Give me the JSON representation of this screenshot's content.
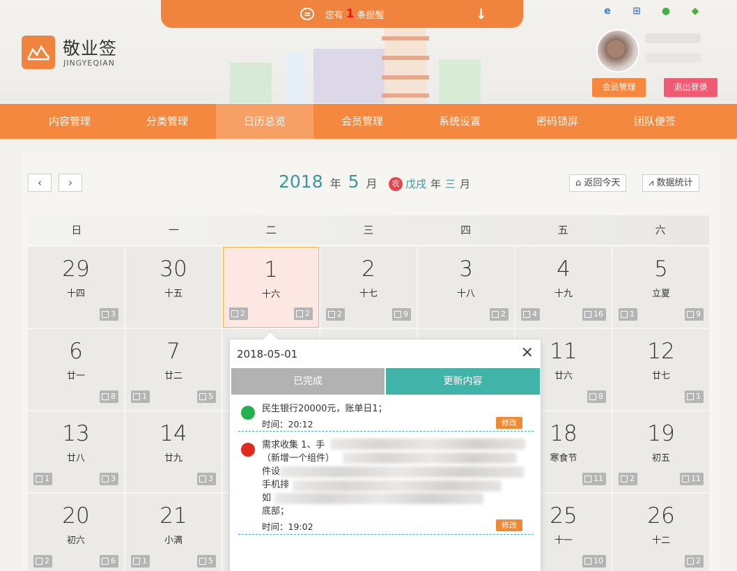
{
  "reminder": {
    "prefix": "您有",
    "count": "1",
    "suffix": "条提醒"
  },
  "brand": {
    "name": "敬业签",
    "sub": "JINGYEQIAN"
  },
  "user": {
    "member_btn": "会员管理",
    "logout_btn": "退出登录"
  },
  "nav": [
    {
      "label": "内容管理",
      "active": false
    },
    {
      "label": "分类管理",
      "active": false
    },
    {
      "label": "日历总览",
      "active": true
    },
    {
      "label": "会员管理",
      "active": false
    },
    {
      "label": "系统设置",
      "active": false
    },
    {
      "label": "密码锁屏",
      "active": false
    },
    {
      "label": "团队便签",
      "active": false
    }
  ],
  "calendar": {
    "year": "2018",
    "year_unit": "年",
    "month": "5",
    "month_unit": "月",
    "lunar_badge": "农",
    "lunar_year": "戊戌",
    "lunar_year_unit": "年",
    "lunar_month": "三",
    "lunar_month_unit": "月",
    "back_today": "返回今天",
    "stats": "数据统计",
    "weekdays": [
      "日",
      "一",
      "二",
      "三",
      "四",
      "五",
      "六"
    ],
    "days": [
      {
        "date": "29",
        "lunar": "十四",
        "left": "",
        "right": "3"
      },
      {
        "date": "30",
        "lunar": "十五",
        "left": "",
        "right": ""
      },
      {
        "date": "1",
        "lunar": "十六",
        "left": "2",
        "right": "2",
        "selected": true
      },
      {
        "date": "2",
        "lunar": "十七",
        "left": "2",
        "right": "9"
      },
      {
        "date": "3",
        "lunar": "十八",
        "left": "",
        "right": "2"
      },
      {
        "date": "4",
        "lunar": "十九",
        "left": "4",
        "right": "16"
      },
      {
        "date": "5",
        "lunar": "立夏",
        "left": "1",
        "right": "9"
      },
      {
        "date": "6",
        "lunar": "廿一",
        "left": "",
        "right": "8"
      },
      {
        "date": "7",
        "lunar": "廿二",
        "left": "1",
        "right": "5"
      },
      {
        "date": "",
        "lunar": "",
        "left": "",
        "right": ""
      },
      {
        "date": "",
        "lunar": "",
        "left": "",
        "right": ""
      },
      {
        "date": "",
        "lunar": "",
        "left": "",
        "right": ""
      },
      {
        "date": "11",
        "lunar": "廿六",
        "left": "",
        "right": "8"
      },
      {
        "date": "12",
        "lunar": "廿七",
        "left": "",
        "right": "1"
      },
      {
        "date": "13",
        "lunar": "廿八",
        "left": "1",
        "right": "3"
      },
      {
        "date": "14",
        "lunar": "廿九",
        "left": "",
        "right": "3"
      },
      {
        "date": "",
        "lunar": "",
        "left": "",
        "right": ""
      },
      {
        "date": "",
        "lunar": "",
        "left": "",
        "right": ""
      },
      {
        "date": "",
        "lunar": "",
        "left": "",
        "right": ""
      },
      {
        "date": "18",
        "lunar": "寒食节",
        "left": "",
        "right": "11"
      },
      {
        "date": "19",
        "lunar": "初五",
        "left": "2",
        "right": "11"
      },
      {
        "date": "20",
        "lunar": "初六",
        "left": "2",
        "right": "6"
      },
      {
        "date": "21",
        "lunar": "小满",
        "left": "1",
        "right": "5"
      },
      {
        "date": "",
        "lunar": "",
        "left": "",
        "right": ""
      },
      {
        "date": "",
        "lunar": "",
        "left": "",
        "right": ""
      },
      {
        "date": "",
        "lunar": "",
        "left": "",
        "right": ""
      },
      {
        "date": "25",
        "lunar": "十一",
        "left": "",
        "right": "10"
      },
      {
        "date": "26",
        "lunar": "十二",
        "left": "",
        "right": "2"
      }
    ]
  },
  "popup": {
    "date": "2018-05-01",
    "close": "×",
    "tab_done": "已完成",
    "tab_update": "更新内容",
    "items": [
      {
        "color": "#22b14c",
        "text": "民生银行20000元，账单日1；",
        "time": "时间：20:12",
        "edit": "修改"
      },
      {
        "color": "#e02a1b",
        "line1": "需求收集 1、手",
        "line2": "（新增一个组件）",
        "line3": "件设",
        "line4": "手机排",
        "line5": "如",
        "line6": "底部；",
        "time": "时间：19:02",
        "edit": "修改"
      }
    ]
  }
}
